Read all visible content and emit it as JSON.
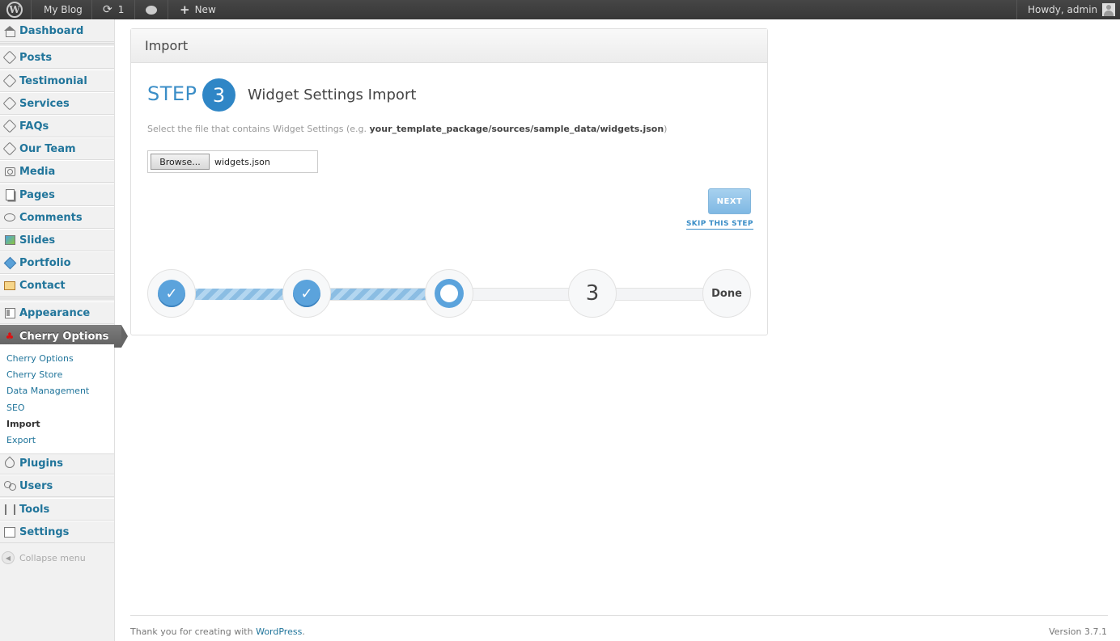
{
  "adminbar": {
    "site_name": "My Blog",
    "updates_count": "1",
    "new_label": "New",
    "howdy": "Howdy, admin"
  },
  "sidebar": {
    "items": [
      {
        "label": "Dashboard",
        "icon": "dashboard-icon"
      },
      {
        "label": "Posts",
        "icon": "pin-icon"
      },
      {
        "label": "Testimonial",
        "icon": "pin-icon"
      },
      {
        "label": "Services",
        "icon": "pin-icon"
      },
      {
        "label": "FAQs",
        "icon": "pin-icon"
      },
      {
        "label": "Our Team",
        "icon": "pin-icon"
      },
      {
        "label": "Media",
        "icon": "media-icon"
      },
      {
        "label": "Pages",
        "icon": "pages-icon"
      },
      {
        "label": "Comments",
        "icon": "comments-icon"
      },
      {
        "label": "Slides",
        "icon": "slides-icon"
      },
      {
        "label": "Portfolio",
        "icon": "portfolio-icon"
      },
      {
        "label": "Contact",
        "icon": "contact-icon"
      },
      {
        "label": "Appearance",
        "icon": "appearance-icon"
      },
      {
        "label": "Cherry Options",
        "icon": "cherry-icon"
      },
      {
        "label": "Plugins",
        "icon": "plugins-icon"
      },
      {
        "label": "Users",
        "icon": "users-icon"
      },
      {
        "label": "Tools",
        "icon": "tools-icon"
      },
      {
        "label": "Settings",
        "icon": "settings-icon"
      }
    ],
    "submenu": [
      "Cherry Options",
      "Cherry Store",
      "Data Management",
      "SEO",
      "Import",
      "Export"
    ],
    "collapse_label": "Collapse menu"
  },
  "panel": {
    "title": "Import",
    "step_word": "STEP",
    "step_number": "3",
    "step_title": "Widget Settings Import",
    "desc_prefix": "Select the file that contains Widget Settings (e.g. ",
    "desc_path": "your_template_package/sources/sample_data/widgets.json",
    "desc_suffix": ")",
    "browse_label": "Browse...",
    "file_name": "widgets.json",
    "next_label": "NEXT",
    "skip_label": "SKIP THIS STEP",
    "progress": {
      "node_3_label": "3",
      "done_label": "Done"
    }
  },
  "footer": {
    "thanks_prefix": "Thank you for creating with ",
    "wordpress_link": "WordPress",
    "thanks_suffix": ".",
    "version": "Version 3.7.1"
  },
  "colors": {
    "accent": "#21759b",
    "step_blue": "#2f86c6",
    "progress_blue": "#5ba3dc"
  }
}
